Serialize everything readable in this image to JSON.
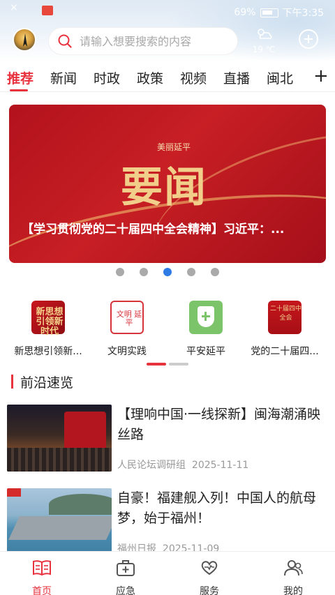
{
  "status_bar": {
    "battery": "69%",
    "time": "下午3:35"
  },
  "search": {
    "placeholder": "请输入想要搜索的内容"
  },
  "weather": {
    "temperature": "19 ℃",
    "icon": "partly-cloudy-icon"
  },
  "tabs": [
    {
      "label": "推荐",
      "active": true
    },
    {
      "label": "新闻"
    },
    {
      "label": "时政"
    },
    {
      "label": "政策"
    },
    {
      "label": "视频"
    },
    {
      "label": "直播"
    },
    {
      "label": "闽北"
    }
  ],
  "banner": {
    "brand": "美丽延平",
    "headline_big": "要闻",
    "caption": "【学习贯彻党的二十届四中全会精神】习近平：...",
    "dots": 5,
    "active_dot": 3
  },
  "quick_links": [
    {
      "label": "新思想引领新...",
      "icon_text": "新思想 引领新时代"
    },
    {
      "label": "文明实践",
      "icon_text": "文明 延平"
    },
    {
      "label": "平安延平",
      "icon": "shield-plus-icon"
    },
    {
      "label": "党的二十届四...",
      "icon_text": "二十届四中全会"
    }
  ],
  "section": {
    "title": "前沿速览"
  },
  "news": [
    {
      "title": "【理响中国·一线探新】闽海潮涌映丝路",
      "source": "人民论坛调研组",
      "date": "2025-11-11"
    },
    {
      "title": "自豪！福建舰入列！中国人的航母梦，始于福州！",
      "source": "福州日报",
      "date": "2025-11-09"
    }
  ],
  "bottom_nav": [
    {
      "label": "首页",
      "icon": "book-icon",
      "active": true
    },
    {
      "label": "应急",
      "icon": "first-aid-kit-icon"
    },
    {
      "label": "服务",
      "icon": "heart-hands-icon"
    },
    {
      "label": "我的",
      "icon": "user-icon"
    }
  ],
  "colors": {
    "accent": "#e8323e",
    "dot_active": "#2f7be6"
  }
}
